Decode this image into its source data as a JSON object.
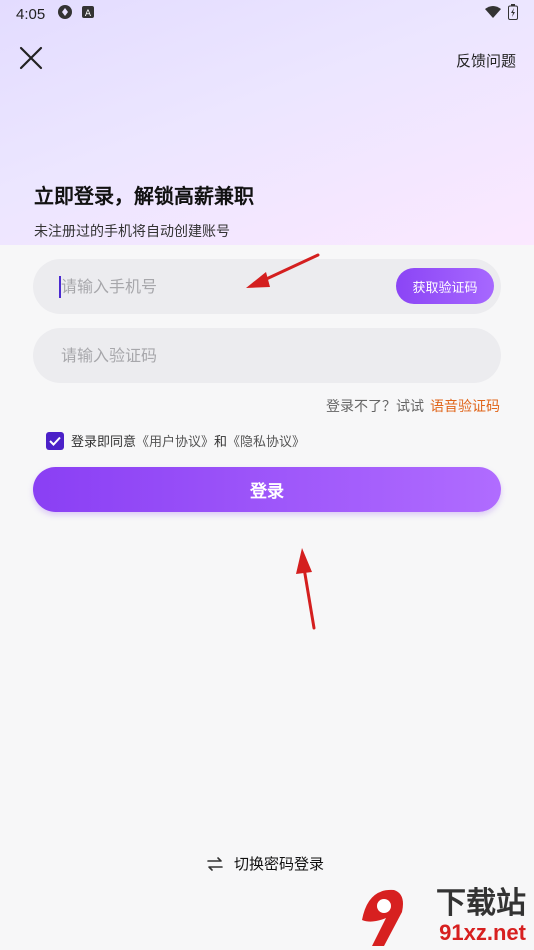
{
  "status_bar": {
    "time": "4:05",
    "icons": [
      "sync-icon",
      "notification-a-icon",
      "wifi-icon",
      "battery-charging-icon"
    ]
  },
  "header": {
    "close_icon": "close-icon",
    "feedback_label": "反馈问题"
  },
  "hero": {
    "title": "立即登录，解锁高薪兼职",
    "subtitle": "未注册过的手机将自动创建账号"
  },
  "form": {
    "phone_placeholder": "请输入手机号",
    "get_code_label": "获取验证码",
    "code_placeholder": "请输入验证码",
    "voice_prompt": "登录不了？试试",
    "voice_link": "语音验证码",
    "agree_prefix": "登录即同意",
    "user_agreement": "《用户协议》",
    "agree_and": "和",
    "privacy_policy": "《隐私协议》",
    "agree_checked": true,
    "login_label": "登录"
  },
  "footer": {
    "switch_label": "切换密码登录",
    "switch_icon": "swap-icon"
  },
  "watermark": {
    "brand": "下载站",
    "domain": "91xz.net"
  },
  "colors": {
    "accent": "#8a3ff4",
    "checkbox": "#4b20c8",
    "link_orange": "#e0651a",
    "annotation_arrow": "#d41f1f"
  }
}
